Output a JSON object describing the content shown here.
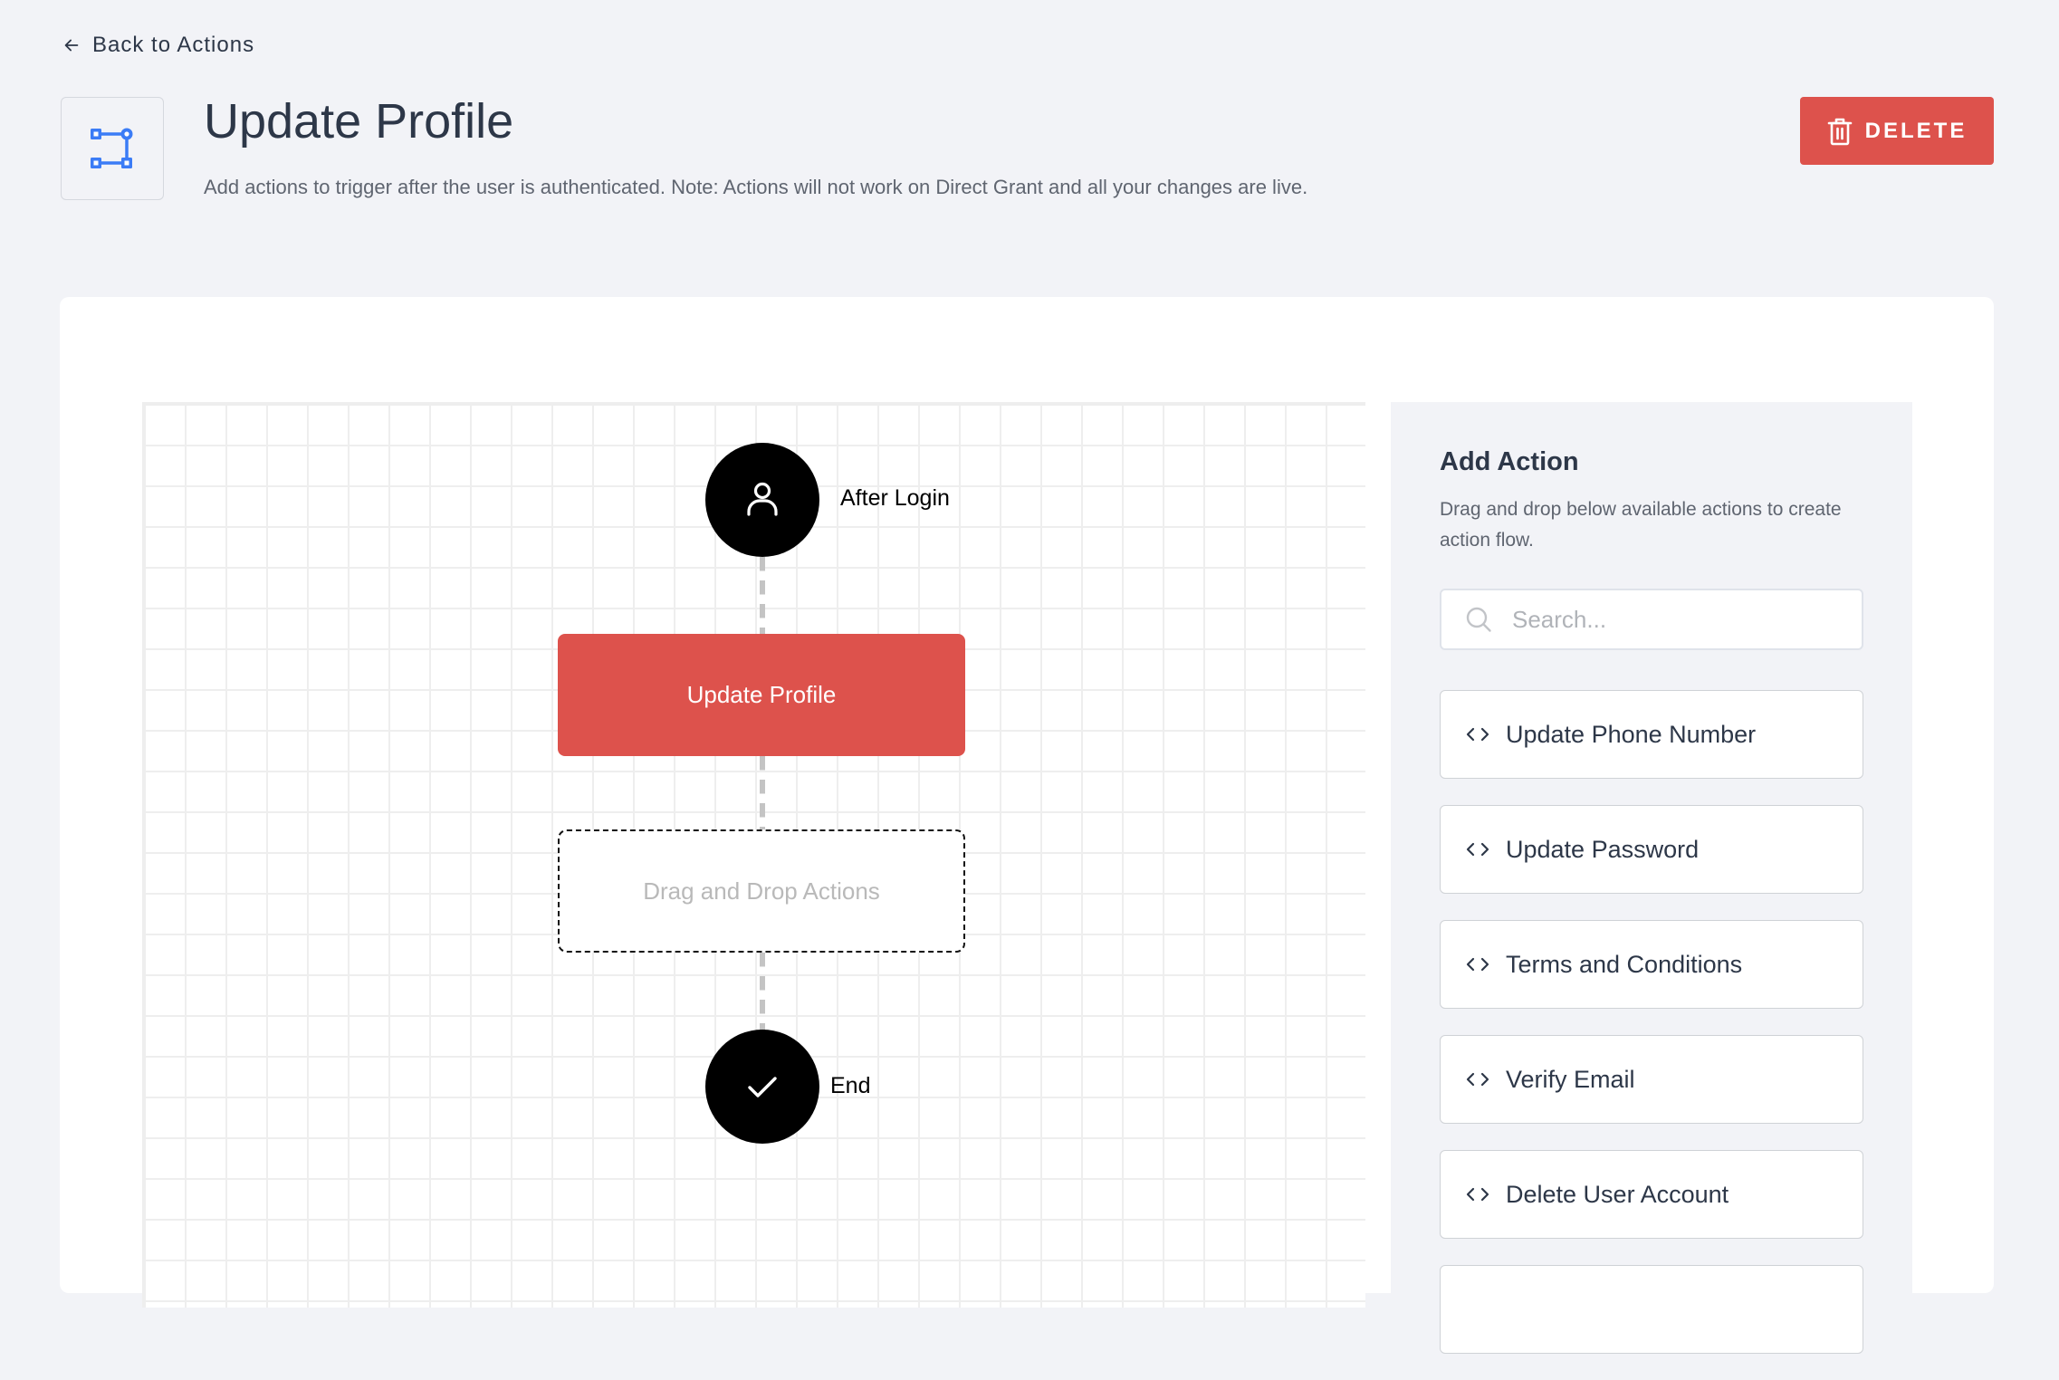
{
  "nav": {
    "back_label": "Back to Actions"
  },
  "header": {
    "title": "Update Profile",
    "subtitle": "Add actions to trigger after the user is authenticated. Note: Actions will not work on Direct Grant and all your changes are live.",
    "icon": "flow-icon",
    "delete_label": "DELETE"
  },
  "colors": {
    "accent": "#dd524c",
    "icon_blue": "#3b7cf6",
    "background": "#f2f3f7"
  },
  "flow": {
    "start_node": {
      "label": "After Login",
      "icon": "user-icon"
    },
    "action_nodes": [
      {
        "label": "Update Profile"
      }
    ],
    "drop_zone_label": "Drag and Drop Actions",
    "end_node": {
      "label": "End",
      "icon": "check-icon"
    }
  },
  "panel": {
    "title": "Add Action",
    "description": "Drag and drop below available actions to create action flow.",
    "search_placeholder": "Search...",
    "search_value": "",
    "actions": [
      {
        "label": "Update Phone Number",
        "icon": "code-icon"
      },
      {
        "label": "Update Password",
        "icon": "code-icon"
      },
      {
        "label": "Terms and Conditions",
        "icon": "code-icon"
      },
      {
        "label": "Verify Email",
        "icon": "code-icon"
      },
      {
        "label": "Delete User Account",
        "icon": "code-icon"
      },
      {
        "label": "",
        "icon": "code-icon"
      }
    ]
  }
}
